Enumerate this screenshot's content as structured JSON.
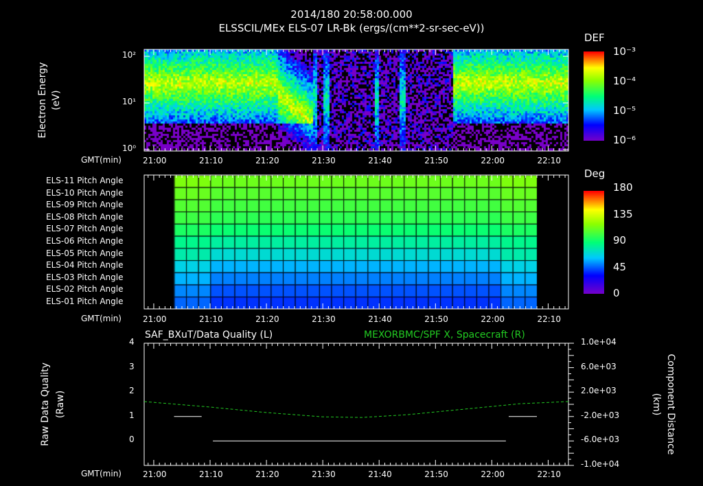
{
  "header": {
    "title": "2014/180 20:58:00.000",
    "subtitle": "ELSSCIL/MEx ELS-07 LR-Bk  (ergs/(cm**2-sr-sec-eV))"
  },
  "chart_data": [
    {
      "type": "heatmap",
      "name": "electron-spectrogram",
      "ylabel": "Electron Energy\n(eV)",
      "ylabel_lines": [
        "Electron Energy",
        "(eV)"
      ],
      "yscale": "log",
      "ylim": [
        1,
        140
      ],
      "ytick_labels": [
        "10²",
        "10¹",
        "10⁰"
      ],
      "ytick_values": [
        100,
        10,
        1
      ],
      "xlabel": "GMT(min)",
      "xlim_min": [
        -1.7,
        73.6
      ],
      "xtick_labels": [
        "21:00",
        "21:10",
        "21:20",
        "21:30",
        "21:40",
        "21:50",
        "22:00",
        "22:10"
      ],
      "colorbar": {
        "title": "DEF",
        "labels": [
          "10⁻³",
          "10⁻⁴",
          "10⁻⁵",
          "10⁻⁶"
        ],
        "range": [
          1e-06,
          0.001
        ]
      },
      "features": {
        "high_flux_until_min": 22,
        "low_flux_from_min": 28,
        "low_flux_until_min": 52,
        "high_flux_from_min": 53,
        "bursts_min": [
          28.5,
          30.5,
          39.5,
          44
        ]
      }
    },
    {
      "type": "heatmap",
      "name": "pitch-angle",
      "rows": [
        "ELS-11 Pitch Angle",
        "ELS-10 Pitch Angle",
        "ELS-09 Pitch Angle",
        "ELS-08 Pitch Angle",
        "ELS-07 Pitch Angle",
        "ELS-06 Pitch Angle",
        "ELS-05 Pitch Angle",
        "ELS-04 Pitch Angle",
        "ELS-03 Pitch Angle",
        "ELS-02 Pitch Angle",
        "ELS-01 Pitch Angle"
      ],
      "row_values_deg": [
        115,
        110,
        105,
        100,
        92,
        82,
        72,
        60,
        52,
        45,
        40
      ],
      "data_range_min": [
        3.6,
        68
      ],
      "xlabel": "GMT(min)",
      "xtick_labels": [
        "21:00",
        "21:10",
        "21:20",
        "21:30",
        "21:40",
        "21:50",
        "22:00",
        "22:10"
      ],
      "colorbar": {
        "title": "Deg",
        "labels": [
          "180",
          "135",
          "90",
          "45",
          "0"
        ],
        "range": [
          0,
          180
        ]
      }
    },
    {
      "type": "line",
      "name": "data-quality",
      "title_left": "SAF_BXuT/Data Quality (L)",
      "title_right": "MEXORBMC/SPF X, Spacecraft (R)",
      "ylabel_left": "Raw Data Quality\n(Raw)",
      "ylabel_left_lines": [
        "Raw Data Quality",
        "(Raw)"
      ],
      "ylim_left": [
        -1,
        4
      ],
      "ytick_left": [
        "4",
        "3",
        "2",
        "1",
        "0"
      ],
      "ylabel_right_lines": [
        "Component Distance",
        "(km)"
      ],
      "ylim_right": [
        -10000,
        10000
      ],
      "ytick_right": [
        "1.0e+04",
        "6.0e+03",
        "2.0e+03",
        "-2.0e+03",
        "-6.0e+03",
        "-1.0e+04"
      ],
      "xlabel": "GMT(min)",
      "xtick_labels": [
        "21:00",
        "21:10",
        "21:20",
        "21:30",
        "21:40",
        "21:50",
        "22:00",
        "22:10"
      ],
      "quality_segments": [
        {
          "from": 3.6,
          "to": 8.5,
          "value": 1
        },
        {
          "from": 10.5,
          "to": 62.5,
          "value": 0
        },
        {
          "from": 63,
          "to": 68,
          "value": 1
        }
      ],
      "spf_x_km": {
        "min": [
          -1.7,
          10,
          20,
          30,
          37,
          45,
          55,
          65,
          73.6
        ],
        "values": [
          450,
          -450,
          -1350,
          -2050,
          -2150,
          -1700,
          -800,
          100,
          450
        ]
      },
      "colors": {
        "quality": "#ffffff",
        "spf_x": "#22cc22"
      }
    }
  ]
}
